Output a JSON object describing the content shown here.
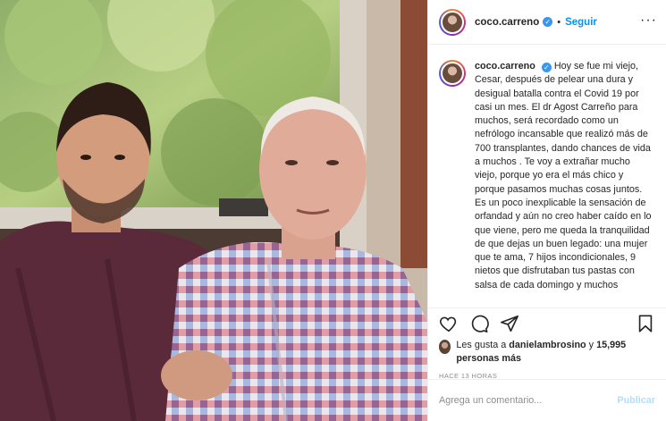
{
  "post": {
    "username": "coco.carreno",
    "dot": "•",
    "follow_label": "Seguir",
    "more_label": "···",
    "verified_mark": "✓"
  },
  "caption": {
    "username": "coco.carreno",
    "text": "Hoy se fue mi viejo, Cesar, después de pelear una dura y desigual batalla contra el Covid 19 por casi un mes. El dr Agost Carreño para muchos, será recordado como un nefrólogo incansable que realizó más de 700 transplantes, dando chances de vida a muchos . Te voy a extrañar mucho viejo, porque yo era el más chico y porque pasamos muchas cosas juntos. Es un poco inexplicable la sensación de orfandad y aún no creo haber caído en lo que viene, pero me queda la tranquilidad de que dejas un buen legado: una mujer que te ama, 7 hijos incondicionales, 9 nietos que disfrutaban tus pastas con salsa de cada domingo y muchos"
  },
  "likes": {
    "prefix": "Les gusta a",
    "user": "danielambrosino",
    "connector": "y",
    "others": "15,995 personas más"
  },
  "timestamp": "HACE 13 HORAS",
  "comment": {
    "placeholder": "Agrega un comentario...",
    "publish_label": "Publicar"
  },
  "icons": {
    "verified": "verified-badge-icon",
    "like": "heart-icon",
    "comment": "comment-icon",
    "share": "share-icon",
    "save": "bookmark-icon",
    "more": "more-options-icon"
  },
  "colors": {
    "link_blue": "#0095f6",
    "verified_blue": "#3897f0",
    "publish_disabled": "#b2dffc",
    "muted_gray": "#8e8e8e",
    "border": "#efefef",
    "text": "#262626"
  }
}
